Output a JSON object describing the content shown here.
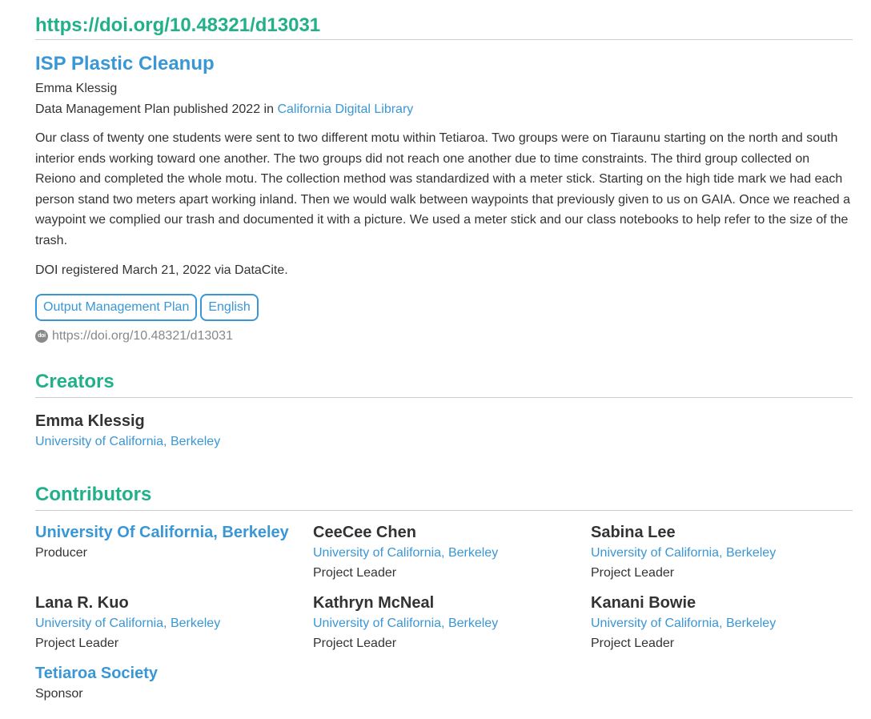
{
  "doi_url": "https://doi.org/10.48321/d13031",
  "work": {
    "title": "ISP Plastic Cleanup",
    "author": "Emma Klessig",
    "published_prefix": "Data Management Plan published 2022 in",
    "publisher": "California Digital Library",
    "description": "Our class of twenty one students were sent to two different motu within Tetiaroa. Two groups were on Tiaraunu starting on the north and south interior ends working toward one another. The two groups did not reach one another due to time constraints. The third group collected on Reiono and completed the whole motu. The collection method was standardized with a meter stick. Starting on the high tide mark we had each person stand two meters apart working inland. Then we would walk between waypoints that previously given to us on GAIA. Once we reached a waypoint we complied our trash and documented it with a picture. We used a meter stick and our class notebooks to help refer to the size of the trash.",
    "registered": "DOI registered March 21, 2022 via DataCite.",
    "tags": [
      "Output Management Plan",
      "English"
    ],
    "doi_icon_text": "doi",
    "doi_link": "https://doi.org/10.48321/d13031"
  },
  "creators": {
    "heading": "Creators",
    "items": [
      {
        "name": "Emma Klessig",
        "affiliation": "University of California, Berkeley"
      }
    ]
  },
  "contributors": {
    "heading": "Contributors",
    "items": [
      {
        "name": "University Of California, Berkeley",
        "affiliation": "",
        "role": "Producer"
      },
      {
        "name": "CeeCee Chen",
        "affiliation": "University of California, Berkeley",
        "role": "Project Leader"
      },
      {
        "name": "Sabina Lee",
        "affiliation": "University of California, Berkeley",
        "role": "Project Leader"
      },
      {
        "name": "Lana R. Kuo",
        "affiliation": "University of California, Berkeley",
        "role": "Project Leader"
      },
      {
        "name": "Kathryn McNeal",
        "affiliation": "University of California, Berkeley",
        "role": "Project Leader"
      },
      {
        "name": "Kanani Bowie",
        "affiliation": "University of California, Berkeley",
        "role": "Project Leader"
      },
      {
        "name": "Tetiaroa Society",
        "affiliation": "",
        "role": "Sponsor"
      }
    ]
  },
  "colors": {
    "heading_green": "#22b08b",
    "link_blue": "#3a97d6",
    "text": "#333333",
    "muted": "#888888"
  }
}
